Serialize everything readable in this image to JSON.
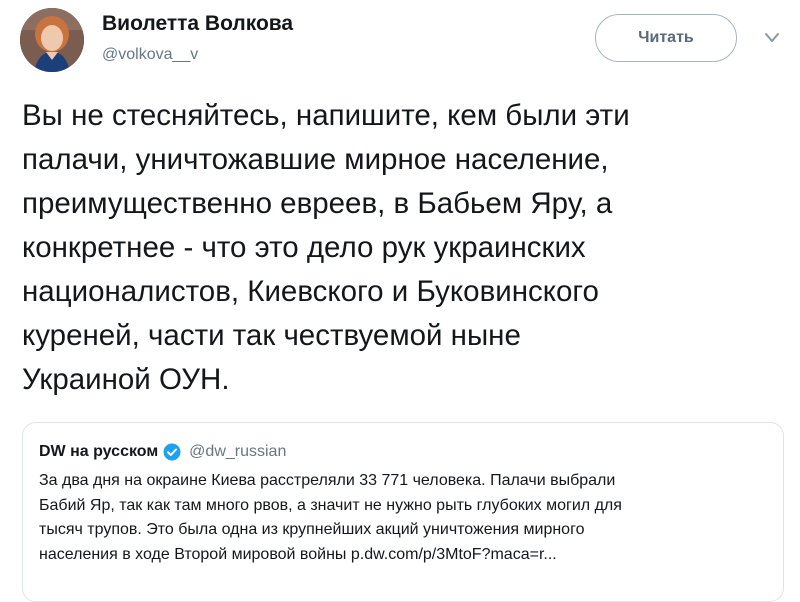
{
  "author": {
    "name": "Виолетта Волкова",
    "handle": "@volkova__v",
    "avatar_icon": "person-photo-avatar"
  },
  "follow_button": {
    "label": "Читать",
    "border_color": "#a8b4bd"
  },
  "caret_icon": "chevron-down-icon",
  "tweet": {
    "lines": [
      "Вы не стесняйтесь, напишите, кем были эти",
      "палачи, уничтожавшие мирное население,",
      "преимущественно евреев, в Бабьем Яру, а",
      "конкретнее - что это дело рук украинских",
      "националистов, Киевского и Буковинского",
      "куреней, части так чествуемой ныне",
      "Украиной ОУН."
    ]
  },
  "quoted_tweet": {
    "name": "DW на русском",
    "verified_icon": "verified-badge-icon",
    "verified_color": "#1da1f2",
    "handle": "@dw_russian",
    "lines": [
      "За два дня на окраине Киева расстреляли 33 771 человека. Палачи выбрали",
      "Бабий Яр, так как там много рвов, а значит не нужно рыть глубоких могил для",
      "тысяч трупов. Это была одна из крупнейших акций уничтожения мирного",
      "населения в ходе Второй мировой войны p.dw.com/p/3MtoF?maca=r..."
    ]
  }
}
